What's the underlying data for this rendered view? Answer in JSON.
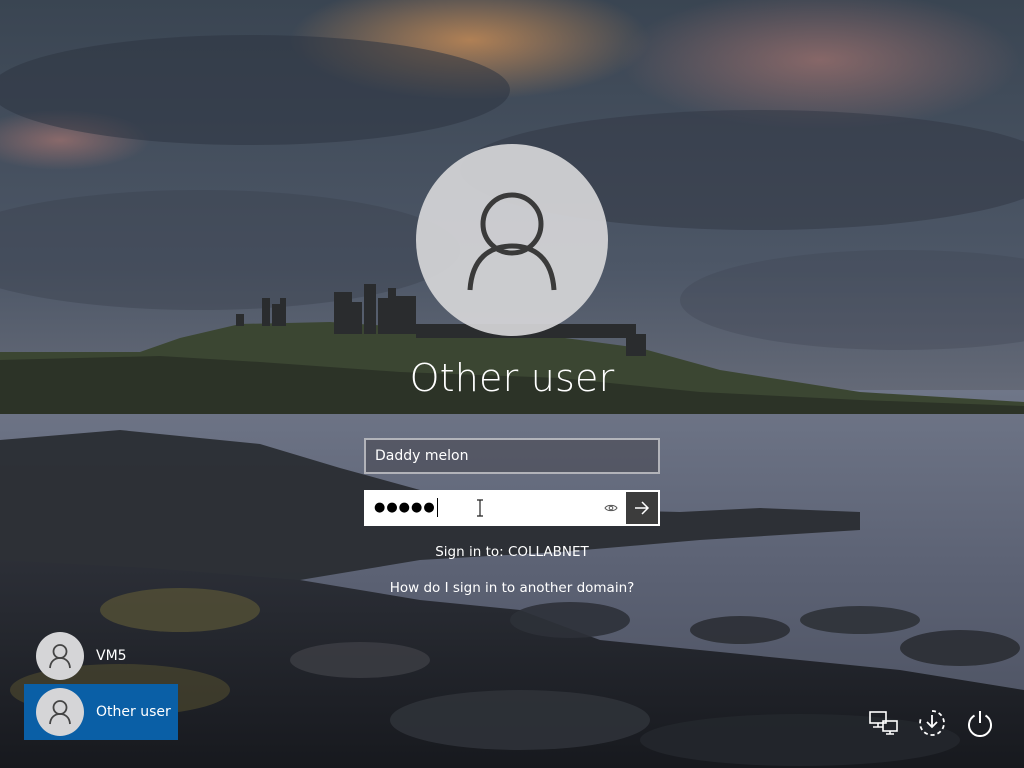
{
  "login": {
    "display_name": "Other user",
    "username_value": "Daddy melon",
    "password_mask": "●●●●●",
    "sign_in_to": "Sign in to: COLLABNET",
    "other_domain_link": "How do I sign in to another domain?"
  },
  "users": [
    {
      "label": "VM5",
      "selected": false
    },
    {
      "label": "Other user",
      "selected": true
    }
  ],
  "tray": {
    "icons": [
      "network-icon",
      "ease-of-access-icon",
      "power-icon"
    ]
  },
  "colors": {
    "selected_tile": "#0a5fa6",
    "submit_button": "#3c3c3c",
    "avatar_bg": "#d5d5d7"
  }
}
